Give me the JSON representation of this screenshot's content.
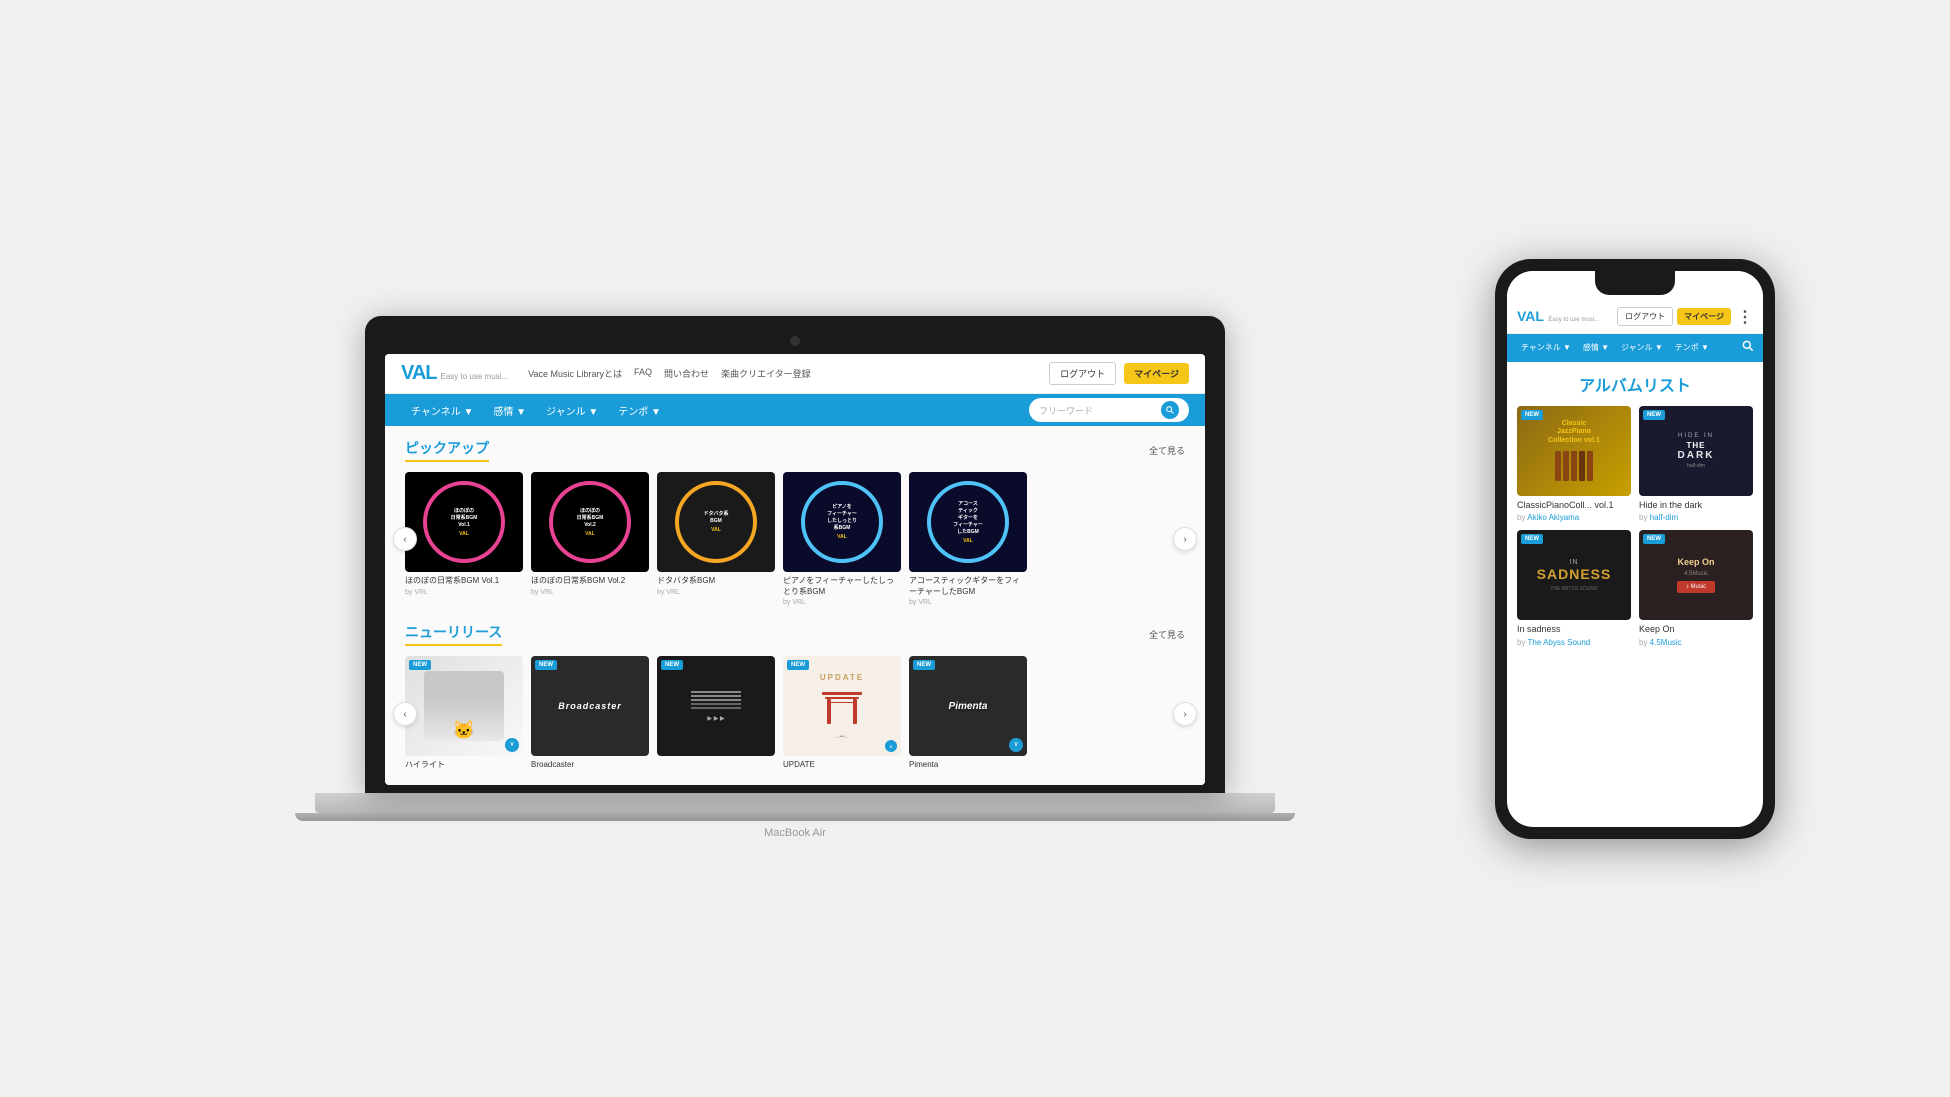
{
  "laptop": {
    "model": "MacBook Air",
    "header": {
      "logo": "VAL",
      "tagline": "Easy to use musi...",
      "nav_links": [
        "Vace Music Libraryとは",
        "FAQ",
        "問い合わせ",
        "楽曲クリエイター登録"
      ],
      "btn_logout": "ログアウト",
      "btn_mypage": "マイページ"
    },
    "navbar": {
      "items": [
        "チャンネル ▼",
        "感情 ▼",
        "ジャンル ▼",
        "テンポ ▼"
      ],
      "search_placeholder": "フリーワード"
    },
    "pickup": {
      "title": "ピックアップ",
      "see_all": "全て見る",
      "albums": [
        {
          "name": "ほのぼの日常系BGM Vol.1",
          "by": "by VRL",
          "ring_color": "#e84393"
        },
        {
          "name": "ほのぼの日常系BGM Vol.2",
          "by": "by VRL",
          "ring_color": "#e84393"
        },
        {
          "name": "ドタバタ系BGM",
          "by": "by VRL",
          "ring_color": "#f5a623"
        },
        {
          "name": "ピアノをフィーチャーしたしっとり系BGM",
          "by": "by VRL",
          "ring_color": "#4fc3f7"
        },
        {
          "name": "アコースティックギターをフィーチャーしたBGM",
          "by": "by VRL",
          "ring_color": "#4fc3f7"
        }
      ]
    },
    "new_releases": {
      "title": "ニューリリース",
      "see_all": "全て見る",
      "albums": [
        {
          "name": "ハイライト",
          "by": "",
          "has_new": true
        },
        {
          "name": "Broadcaster",
          "by": "",
          "has_new": true
        },
        {
          "name": "",
          "by": "",
          "has_new": true
        },
        {
          "name": "UPDATE",
          "by": "",
          "has_new": true
        },
        {
          "name": "Pimenta",
          "by": "",
          "has_new": true
        }
      ]
    }
  },
  "phone": {
    "header": {
      "logo": "VAL",
      "tagline": "Easy to use musi...",
      "btn_logout": "ログアウト",
      "btn_mypage": "マイページ"
    },
    "navbar": {
      "items": [
        "チャンネル ▼",
        "感情 ▼",
        "ジャンル ▼",
        "テンポ ▼"
      ]
    },
    "content": {
      "title": "アルバムリスト",
      "albums": [
        {
          "name": "ClassicPianoColl... vol.1",
          "by": "Akiko Akiyama",
          "has_new": true
        },
        {
          "name": "Hide in the dark",
          "by": "half-dim",
          "has_new": true
        },
        {
          "name": "In sadness",
          "by": "The Abyss Sound",
          "has_new": true
        },
        {
          "name": "Keep On",
          "by": "4.5Music",
          "has_new": true
        }
      ]
    }
  }
}
